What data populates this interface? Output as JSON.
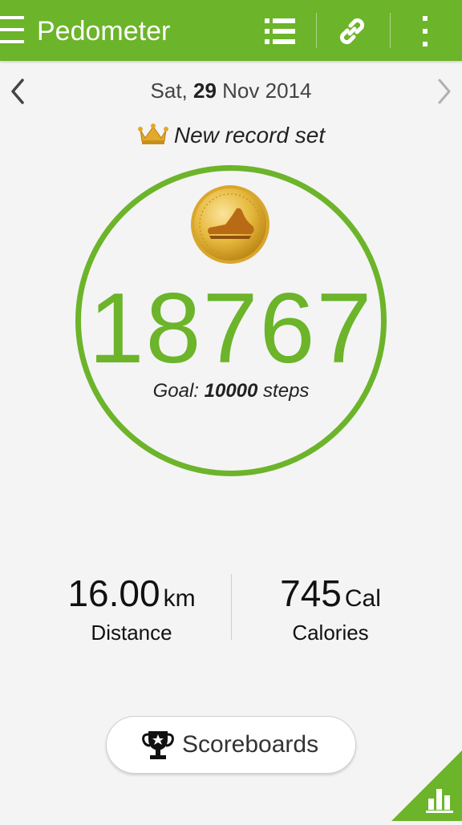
{
  "appbar": {
    "title": "Pedometer",
    "icons": [
      "menu-icon",
      "list-icon",
      "link-icon",
      "more-vert-icon"
    ],
    "color": "#6cb42a"
  },
  "date_nav": {
    "weekday": "Sat,",
    "day": "29",
    "month_year": "Nov 2014"
  },
  "record": {
    "text": "New record set",
    "icon": "crown-icon"
  },
  "steps": {
    "count": "18767",
    "goal_prefix": "Goal:",
    "goal_value": "10000",
    "goal_suffix": "steps",
    "medal_icon": "shoe-medal-icon"
  },
  "stats": {
    "distance": {
      "value": "16.00",
      "unit": "km",
      "label": "Distance"
    },
    "calories": {
      "value": "745",
      "unit": "Cal",
      "label": "Calories"
    }
  },
  "scoreboards": {
    "label": "Scoreboards",
    "icon": "trophy-icon"
  },
  "corner": {
    "icon": "bar-chart-icon"
  },
  "colors": {
    "accent": "#6cb42a",
    "gold": "#d8a21e",
    "background": "#f4f4f4"
  }
}
